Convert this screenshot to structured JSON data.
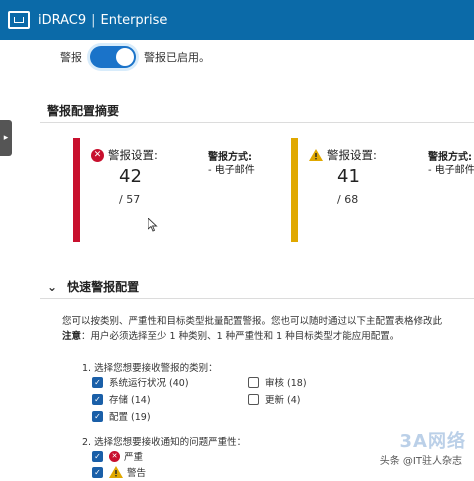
{
  "header": {
    "product": "iDRAC9",
    "edition": "Enterprise"
  },
  "alert_toggle": {
    "label": "警报",
    "status": "警报已启用。",
    "enabled": true
  },
  "summary": {
    "title": "警报配置摘要",
    "cards": [
      {
        "title": "警报设置:",
        "count": "42",
        "total": "/ 57",
        "method_label": "警报方式:",
        "method_value": "- 电子邮件",
        "severity": "error",
        "color": "#c8102e"
      },
      {
        "title": "警报设置:",
        "count": "41",
        "total": "/ 68",
        "method_label": "警报方式:",
        "method_value": "- 电子邮件",
        "severity": "warning",
        "color": "#e0a800"
      }
    ]
  },
  "quick_config": {
    "title": "快速警报配置",
    "desc_line1": "您可以按类别、严重性和目标类型批量配置警报。您也可以随时通过以下主配置表格修改此",
    "desc_note_label": "注意",
    "desc_line2": "：用户必须选择至少 1 种类别、1 种严重性和 1 种目标类型才能应用配置。",
    "step1": "1. 选择您想要接收警报的类别：",
    "categories": [
      {
        "label": "系统运行状况 (40)",
        "checked": true
      },
      {
        "label": "存储 (14)",
        "checked": true
      },
      {
        "label": "配置 (19)",
        "checked": true
      },
      {
        "label": "审核 (18)",
        "checked": false
      },
      {
        "label": "更新 (4)",
        "checked": false
      }
    ],
    "step2": "2. 选择您想要接收通知的问题严重性：",
    "severities": [
      {
        "label": "严重",
        "checked": true,
        "icon": "error-icon"
      },
      {
        "label": "警告",
        "checked": true,
        "icon": "warning-icon"
      }
    ]
  },
  "watermark": {
    "text": "头条 @IT驻人杂志",
    "brand": "3A网络"
  }
}
